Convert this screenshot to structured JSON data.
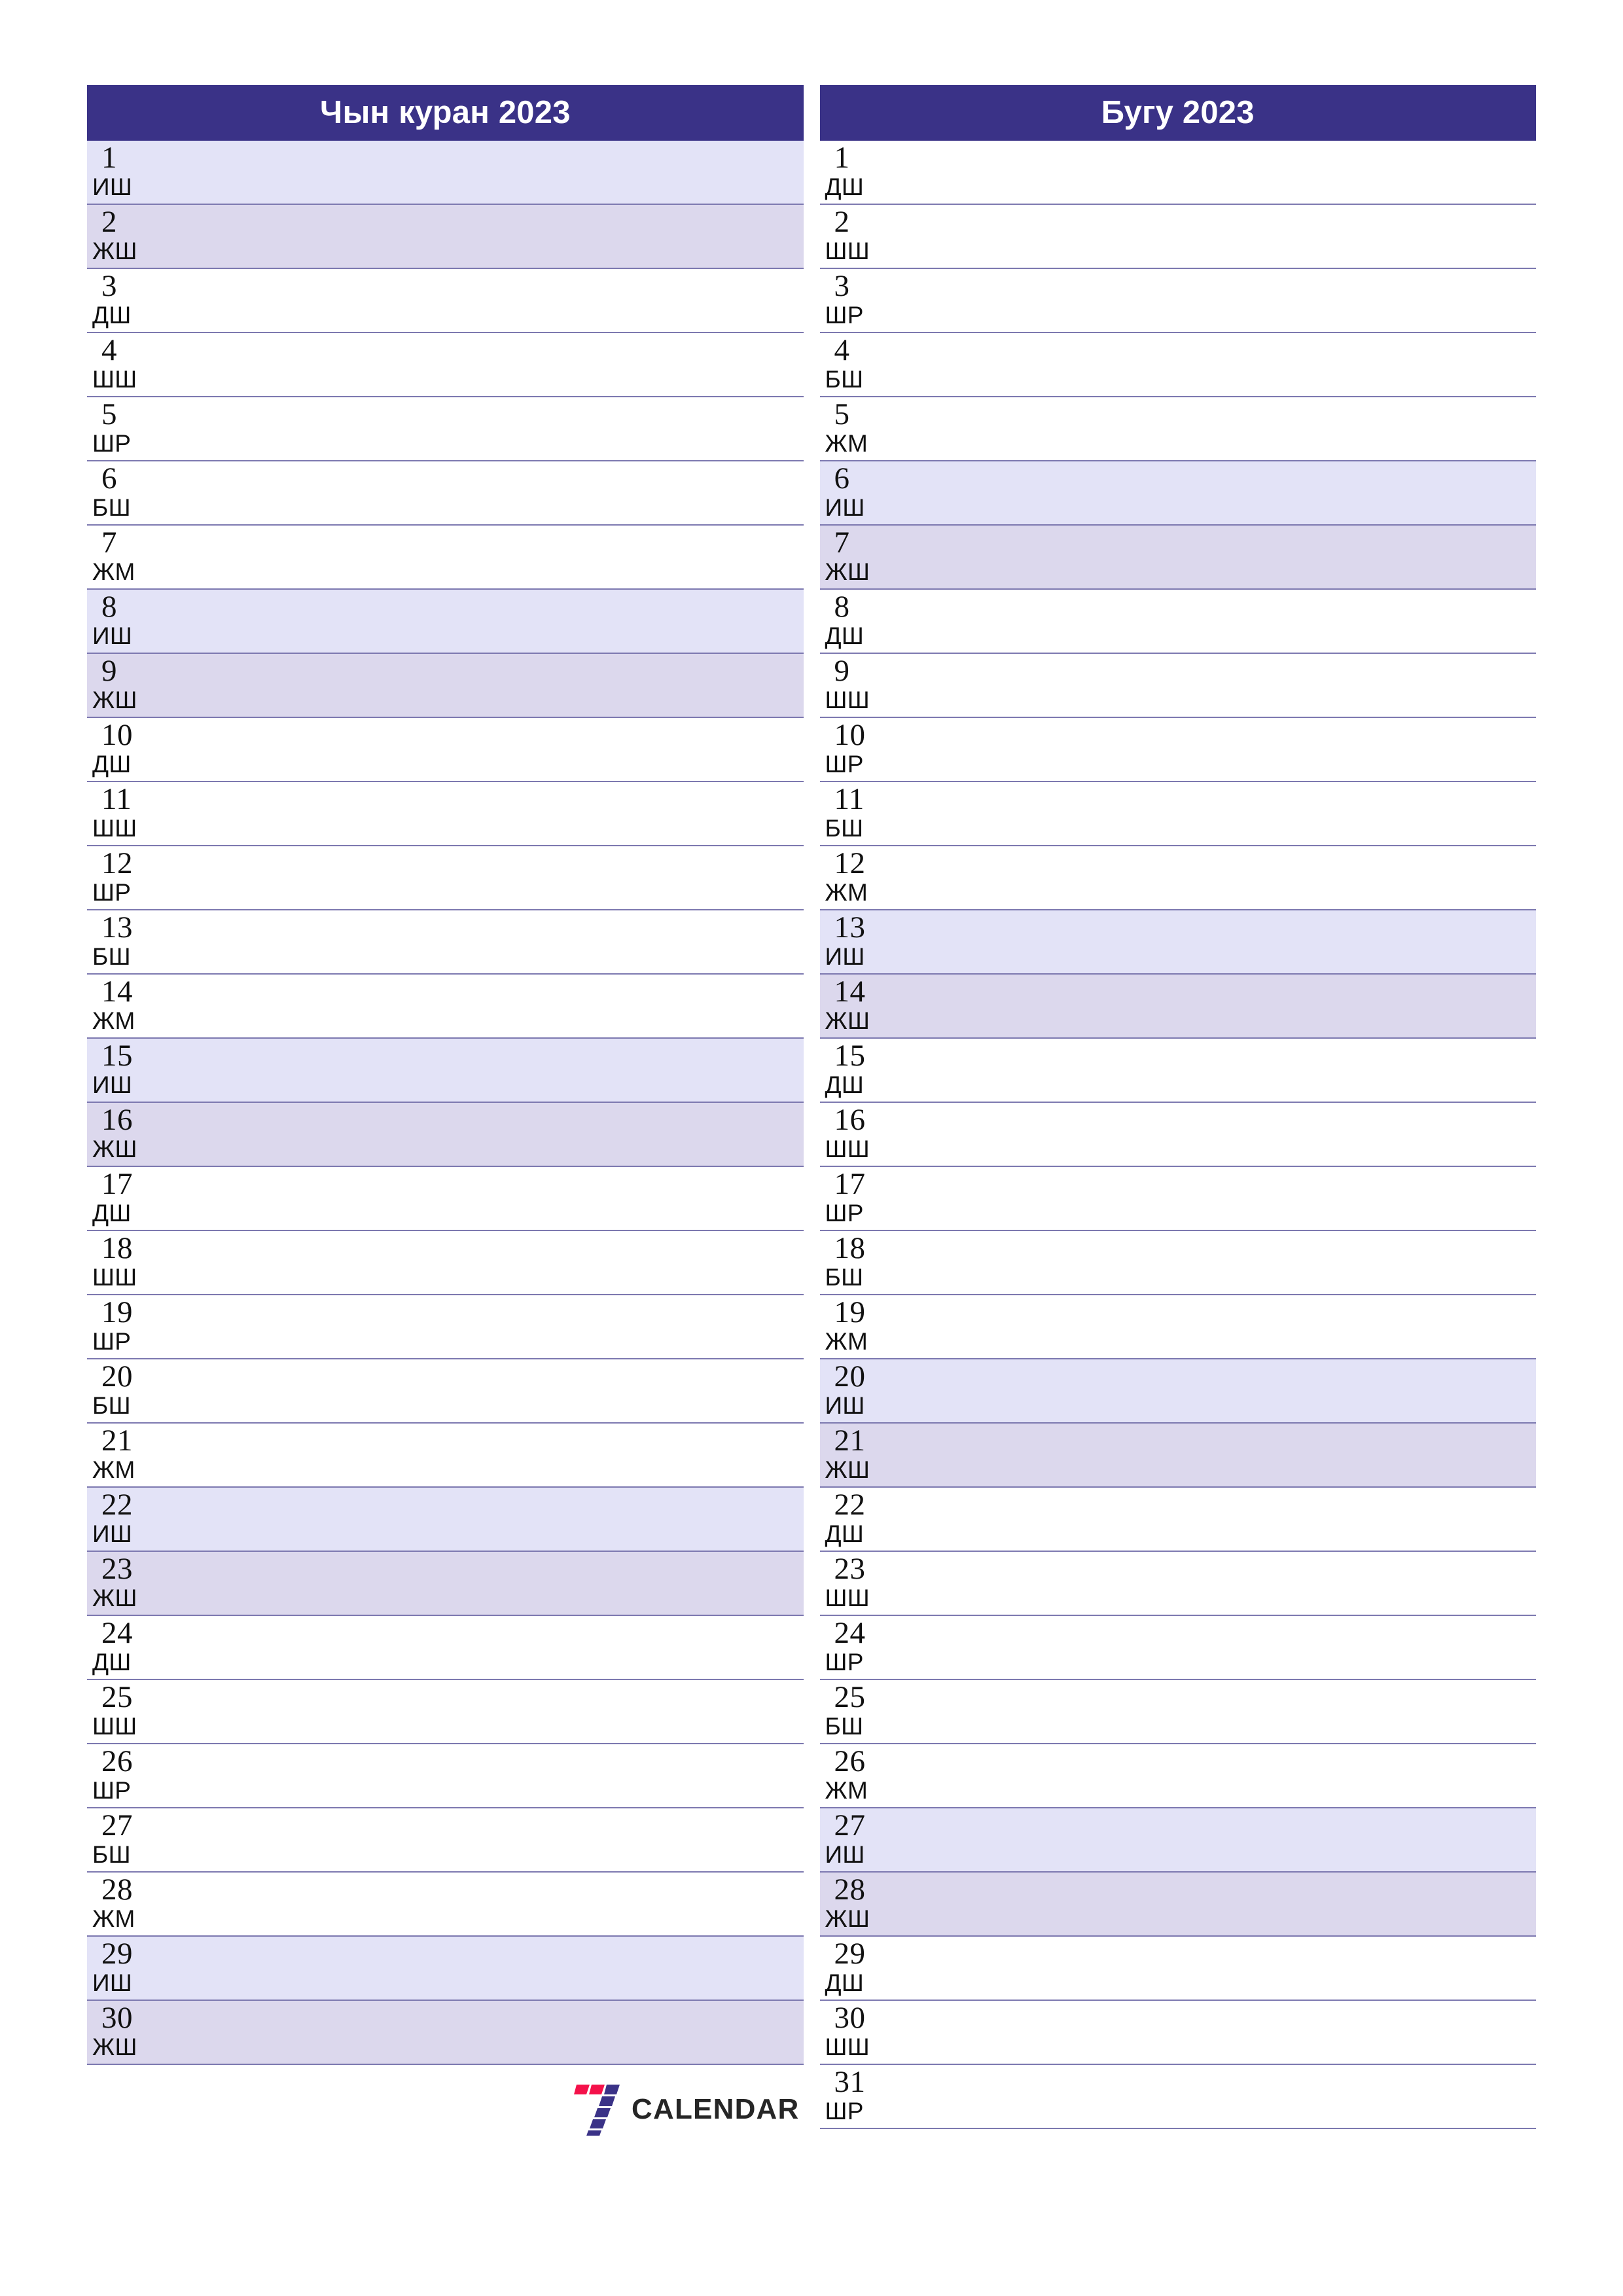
{
  "colors": {
    "header_bg": "#3a3287",
    "header_text": "#ffffff",
    "rule": "#7d79b0",
    "sunday_bg": "#e3e3f7",
    "saturday_bg": "#dcd8ed",
    "logo_red": "#f4114a",
    "logo_blue": "#3a3287",
    "logo_word": "#262626"
  },
  "brand": {
    "word": "CALENDAR",
    "mark_icon": "seven-logo-icon"
  },
  "months": [
    {
      "title": "Чын куран 2023",
      "days": [
        {
          "num": "1",
          "weekday": "ИШ"
        },
        {
          "num": "2",
          "weekday": "ЖШ"
        },
        {
          "num": "3",
          "weekday": "ДШ"
        },
        {
          "num": "4",
          "weekday": "ШШ"
        },
        {
          "num": "5",
          "weekday": "ШР"
        },
        {
          "num": "6",
          "weekday": "БШ"
        },
        {
          "num": "7",
          "weekday": "ЖМ"
        },
        {
          "num": "8",
          "weekday": "ИШ"
        },
        {
          "num": "9",
          "weekday": "ЖШ"
        },
        {
          "num": "10",
          "weekday": "ДШ"
        },
        {
          "num": "11",
          "weekday": "ШШ"
        },
        {
          "num": "12",
          "weekday": "ШР"
        },
        {
          "num": "13",
          "weekday": "БШ"
        },
        {
          "num": "14",
          "weekday": "ЖМ"
        },
        {
          "num": "15",
          "weekday": "ИШ"
        },
        {
          "num": "16",
          "weekday": "ЖШ"
        },
        {
          "num": "17",
          "weekday": "ДШ"
        },
        {
          "num": "18",
          "weekday": "ШШ"
        },
        {
          "num": "19",
          "weekday": "ШР"
        },
        {
          "num": "20",
          "weekday": "БШ"
        },
        {
          "num": "21",
          "weekday": "ЖМ"
        },
        {
          "num": "22",
          "weekday": "ИШ"
        },
        {
          "num": "23",
          "weekday": "ЖШ"
        },
        {
          "num": "24",
          "weekday": "ДШ"
        },
        {
          "num": "25",
          "weekday": "ШШ"
        },
        {
          "num": "26",
          "weekday": "ШР"
        },
        {
          "num": "27",
          "weekday": "БШ"
        },
        {
          "num": "28",
          "weekday": "ЖМ"
        },
        {
          "num": "29",
          "weekday": "ИШ"
        },
        {
          "num": "30",
          "weekday": "ЖШ"
        }
      ]
    },
    {
      "title": "Бугу 2023",
      "days": [
        {
          "num": "1",
          "weekday": "ДШ"
        },
        {
          "num": "2",
          "weekday": "ШШ"
        },
        {
          "num": "3",
          "weekday": "ШР"
        },
        {
          "num": "4",
          "weekday": "БШ"
        },
        {
          "num": "5",
          "weekday": "ЖМ"
        },
        {
          "num": "6",
          "weekday": "ИШ"
        },
        {
          "num": "7",
          "weekday": "ЖШ"
        },
        {
          "num": "8",
          "weekday": "ДШ"
        },
        {
          "num": "9",
          "weekday": "ШШ"
        },
        {
          "num": "10",
          "weekday": "ШР"
        },
        {
          "num": "11",
          "weekday": "БШ"
        },
        {
          "num": "12",
          "weekday": "ЖМ"
        },
        {
          "num": "13",
          "weekday": "ИШ"
        },
        {
          "num": "14",
          "weekday": "ЖШ"
        },
        {
          "num": "15",
          "weekday": "ДШ"
        },
        {
          "num": "16",
          "weekday": "ШШ"
        },
        {
          "num": "17",
          "weekday": "ШР"
        },
        {
          "num": "18",
          "weekday": "БШ"
        },
        {
          "num": "19",
          "weekday": "ЖМ"
        },
        {
          "num": "20",
          "weekday": "ИШ"
        },
        {
          "num": "21",
          "weekday": "ЖШ"
        },
        {
          "num": "22",
          "weekday": "ДШ"
        },
        {
          "num": "23",
          "weekday": "ШШ"
        },
        {
          "num": "24",
          "weekday": "ШР"
        },
        {
          "num": "25",
          "weekday": "БШ"
        },
        {
          "num": "26",
          "weekday": "ЖМ"
        },
        {
          "num": "27",
          "weekday": "ИШ"
        },
        {
          "num": "28",
          "weekday": "ЖШ"
        },
        {
          "num": "29",
          "weekday": "ДШ"
        },
        {
          "num": "30",
          "weekday": "ШШ"
        },
        {
          "num": "31",
          "weekday": "ШР"
        }
      ]
    }
  ]
}
